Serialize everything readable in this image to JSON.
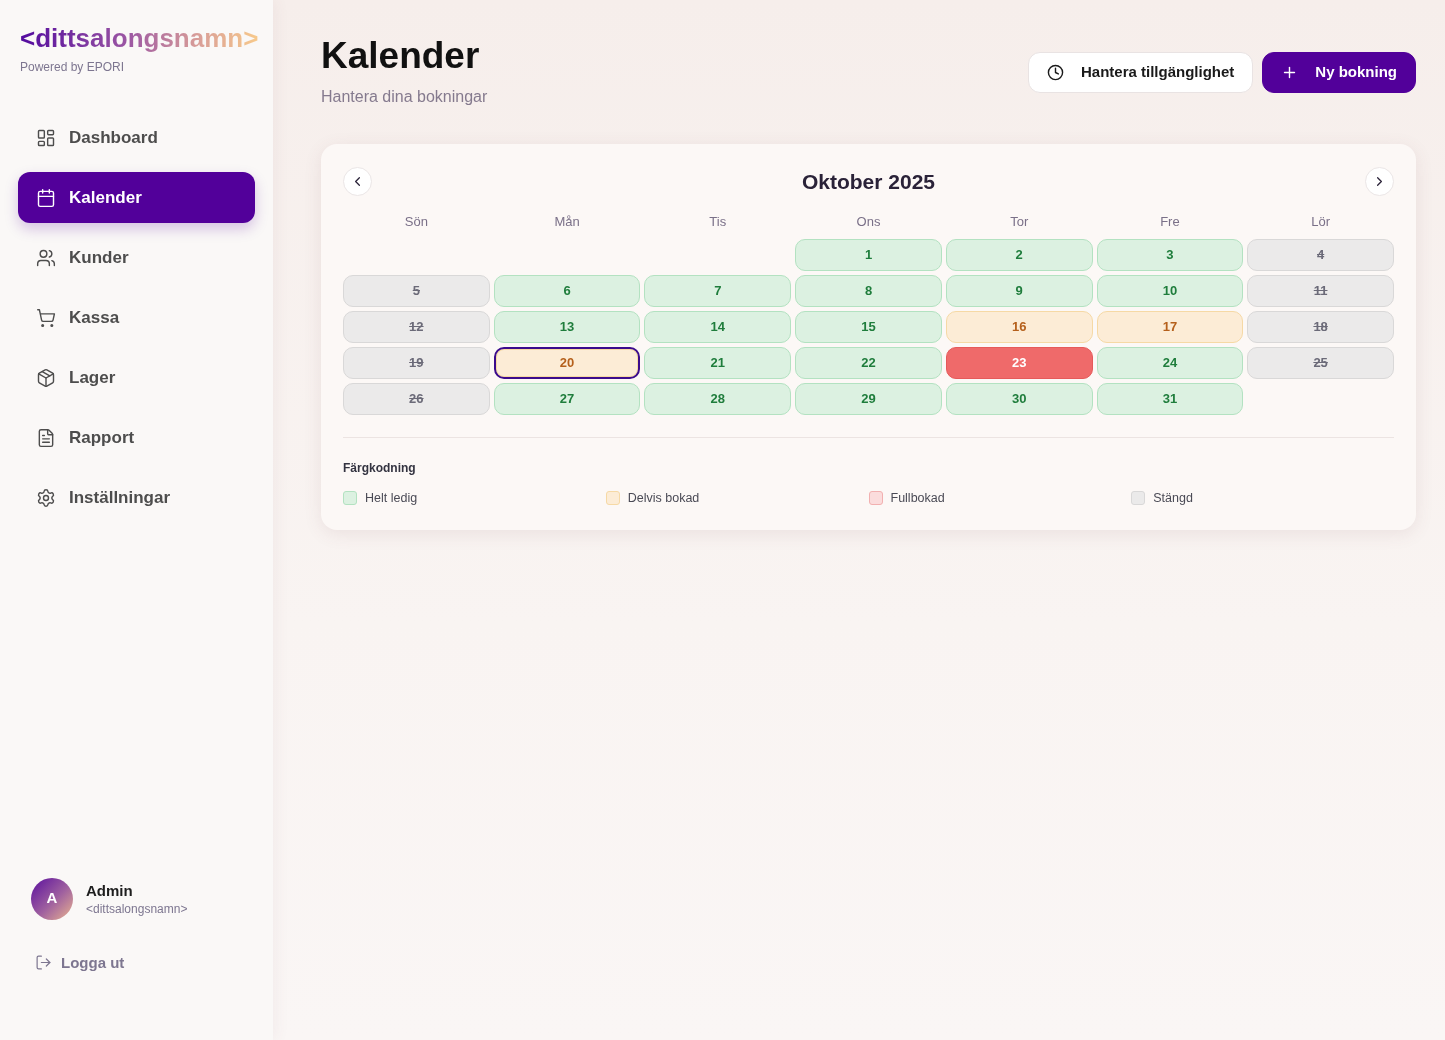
{
  "sidebar": {
    "logo": "<dittsalongsnamn>",
    "powered_by": "Powered by EPORI",
    "items": [
      {
        "label": "Dashboard",
        "selected": false
      },
      {
        "label": "Kalender",
        "selected": true
      },
      {
        "label": "Kunder",
        "selected": false
      },
      {
        "label": "Kassa",
        "selected": false
      },
      {
        "label": "Lager",
        "selected": false
      },
      {
        "label": "Rapport",
        "selected": false
      },
      {
        "label": "Inställningar",
        "selected": false
      }
    ],
    "user": {
      "initial": "A",
      "name": "Admin",
      "salon": "<dittsalongsnamn>"
    },
    "logout": "Logga ut"
  },
  "header": {
    "title": "Kalender",
    "subtitle": "Hantera dina bokningar",
    "buttons": [
      {
        "label": "Hantera tillgänglighet",
        "kind": "secondary"
      },
      {
        "label": "Ny bokning",
        "kind": "primary"
      }
    ]
  },
  "calendar": {
    "month": "Oktober 2025",
    "weekdays": [
      "Sön",
      "Mån",
      "Tis",
      "Ons",
      "Tor",
      "Fre",
      "Lör"
    ],
    "weeks": [
      {
        "days": [
          {
            "day": "1",
            "kind": "available",
            "selected": false
          },
          {
            "day": "2",
            "kind": "available",
            "selected": false
          },
          {
            "day": "3",
            "kind": "available",
            "selected": false
          },
          {
            "day": "4",
            "kind": "closed",
            "selected": false
          }
        ]
      },
      {
        "days": [
          {
            "day": "5",
            "kind": "closed",
            "selected": false
          },
          {
            "day": "6",
            "kind": "available",
            "selected": false
          },
          {
            "day": "7",
            "kind": "available",
            "selected": false
          },
          {
            "day": "8",
            "kind": "available",
            "selected": false
          },
          {
            "day": "9",
            "kind": "available",
            "selected": false
          },
          {
            "day": "10",
            "kind": "available",
            "selected": false
          },
          {
            "day": "11",
            "kind": "closed",
            "selected": false
          }
        ]
      },
      {
        "days": [
          {
            "day": "12",
            "kind": "closed",
            "selected": false
          },
          {
            "day": "13",
            "kind": "available",
            "selected": false
          },
          {
            "day": "14",
            "kind": "available",
            "selected": false
          },
          {
            "day": "15",
            "kind": "available",
            "selected": false
          },
          {
            "day": "16",
            "kind": "partial",
            "selected": false
          },
          {
            "day": "17",
            "kind": "partial",
            "selected": false
          },
          {
            "day": "18",
            "kind": "closed",
            "selected": false
          }
        ]
      },
      {
        "days": [
          {
            "day": "19",
            "kind": "closed",
            "selected": false
          },
          {
            "day": "20",
            "kind": "partial",
            "selected": true
          },
          {
            "day": "21",
            "kind": "available",
            "selected": false
          },
          {
            "day": "22",
            "kind": "available",
            "selected": false
          },
          {
            "day": "23",
            "kind": "full",
            "selected": false
          },
          {
            "day": "24",
            "kind": "available",
            "selected": false
          },
          {
            "day": "25",
            "kind": "closed",
            "selected": false
          }
        ]
      },
      {
        "days": [
          {
            "day": "26",
            "kind": "closed",
            "selected": false
          },
          {
            "day": "27",
            "kind": "available",
            "selected": false
          },
          {
            "day": "28",
            "kind": "available",
            "selected": false
          },
          {
            "day": "29",
            "kind": "available",
            "selected": false
          },
          {
            "day": "30",
            "kind": "available",
            "selected": false
          },
          {
            "day": "31",
            "kind": "available",
            "selected": false
          }
        ]
      }
    ],
    "legend": {
      "title": "Färgkodning",
      "items": [
        {
          "label": "Helt ledig",
          "kind": "available"
        },
        {
          "label": "Delvis bokad",
          "kind": "partial"
        },
        {
          "label": "Fullbokad",
          "kind": "full"
        },
        {
          "label": "Stängd",
          "kind": "closed"
        }
      ]
    }
  }
}
